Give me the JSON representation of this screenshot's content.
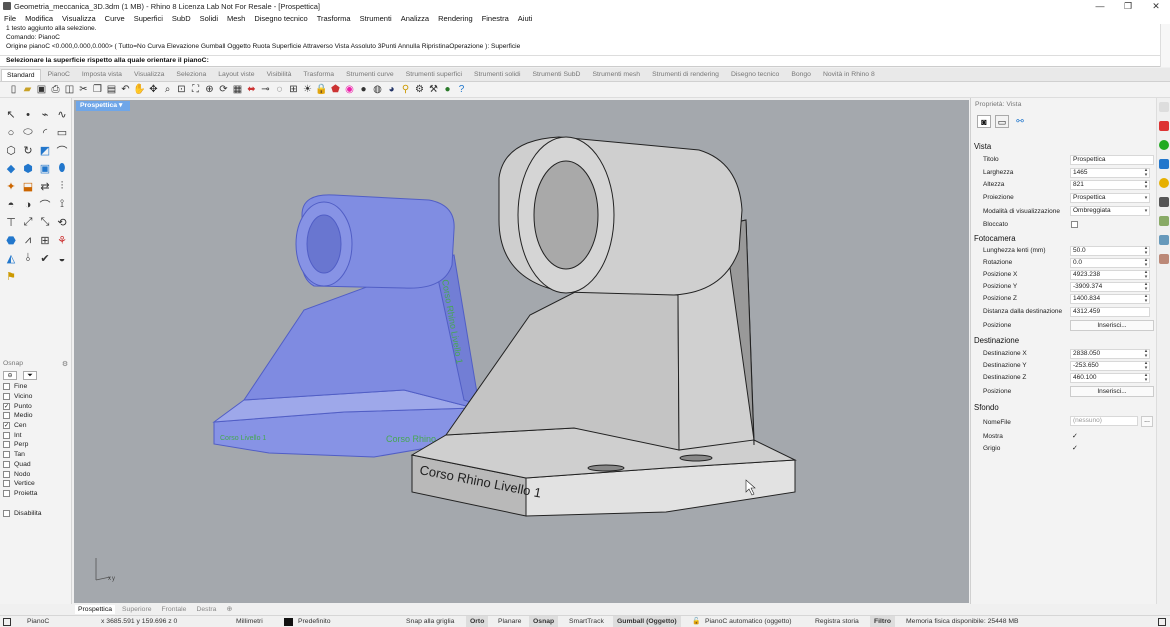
{
  "window": {
    "title": "Geometria_meccanica_3D.3dm (1 MB) - Rhino 8 Licenza Lab Not For Resale - [Prospettica]",
    "minimize": "—",
    "maximize": "❐",
    "close": "✕"
  },
  "menu": [
    "File",
    "Modifica",
    "Visualizza",
    "Curve",
    "Superfici",
    "SubD",
    "Solidi",
    "Mesh",
    "Disegno tecnico",
    "Trasforma",
    "Strumenti",
    "Analizza",
    "Rendering",
    "Finestra",
    "Aiuti"
  ],
  "command": {
    "history": [
      "1 testo aggiunto alla selezione.",
      "Comando: PianoC",
      "Origine pianoC <0.000,0.000,0.000> ( Tutto=No  Curva  Elevazione  Gumball  Oggetto  Ruota  Superficie  Attraverso  Vista  Assoluto  3Punti  Annulla  RipristinaOperazione ): Superficie"
    ],
    "prompt": "Selezionare la superficie rispetto alla quale orientare il pianoC:"
  },
  "toolbar_tabs": [
    "Standard",
    "PianoC",
    "Imposta vista",
    "Visualizza",
    "Seleziona",
    "Layout viste",
    "Visibilità",
    "Trasforma",
    "Strumenti curve",
    "Strumenti superfici",
    "Strumenti solidi",
    "Strumenti SubD",
    "Strumenti mesh",
    "Strumenti di rendering",
    "Disegno tecnico",
    "Bongo",
    "Novità in Rhino 8"
  ],
  "toolbar_tabs_active": 0,
  "viewport": {
    "name": "Prospettica",
    "dropdown": "▾",
    "ghost_text_1": "Corso Rhino Livello 1",
    "ghost_text_2": "Corso Livello 1",
    "ghost_text_3": "Corso Rhino",
    "solid_text": "Corso Rhino Livello 1",
    "axis_x": "x",
    "axis_y": "y"
  },
  "viewport_tabs": [
    "Prospettica",
    "Superiore",
    "Frontale",
    "Destra"
  ],
  "viewport_tabs_add": "⊕",
  "osnap": {
    "title": "Osnap",
    "items": [
      {
        "label": "Fine",
        "checked": false
      },
      {
        "label": "Vicino",
        "checked": false
      },
      {
        "label": "Punto",
        "checked": true
      },
      {
        "label": "Medio",
        "checked": false
      },
      {
        "label": "Cen",
        "checked": true
      },
      {
        "label": "Int",
        "checked": false
      },
      {
        "label": "Perp",
        "checked": false
      },
      {
        "label": "Tan",
        "checked": false
      },
      {
        "label": "Quad",
        "checked": false
      },
      {
        "label": "Nodo",
        "checked": false
      },
      {
        "label": "Vertice",
        "checked": false
      },
      {
        "label": "Proietta",
        "checked": false
      }
    ],
    "disable": "Disabilita"
  },
  "properties": {
    "title": "Proprietà: Vista",
    "vista": {
      "section": "Vista",
      "titolo_label": "Titolo",
      "titolo": "Prospettica",
      "larghezza_label": "Larghezza",
      "larghezza": "1465",
      "altezza_label": "Altezza",
      "altezza": "821",
      "proiezione_label": "Proiezione",
      "proiezione": "Prospettica",
      "modalita_label": "Modalità di visualizzazione",
      "modalita": "Ombreggiata",
      "bloccato_label": "Bloccato"
    },
    "fotocamera": {
      "section": "Fotocamera",
      "lente_label": "Lunghezza lenti (mm)",
      "lente": "50.0",
      "rotazione_label": "Rotazione",
      "rotazione": "0.0",
      "posx_label": "Posizione X",
      "posx": "4923.238",
      "posy_label": "Posizione Y",
      "posy": "-3909.374",
      "posz_label": "Posizione Z",
      "posz": "1400.834",
      "dist_label": "Distanza dalla destinazione",
      "dist": "4312.459",
      "pos_label": "Posizione",
      "pos_btn": "Inserisci..."
    },
    "destinazione": {
      "section": "Destinazione",
      "dx_label": "Destinazione X",
      "dx": "2838.050",
      "dy_label": "Destinazione Y",
      "dy": "-253.650",
      "dz_label": "Destinazione Z",
      "dz": "460.100",
      "pos_label": "Posizione",
      "pos_btn": "Inserisci..."
    },
    "sfondo": {
      "section": "Sfondo",
      "nomefile_label": "NomeFile",
      "nomefile": "(nessuno)",
      "browse": "...",
      "mostra_label": "Mostra",
      "mostra": "✓",
      "grigio_label": "Grigio",
      "grigio": "✓"
    }
  },
  "status": {
    "cplane": "PianoC",
    "coords": "x 3685.591  y 159.696  z 0",
    "units": "Millimetri",
    "layer": "Predefinito",
    "snap": "Snap alla griglia",
    "orto": "Orto",
    "planare": "Planare",
    "osnap": "Osnap",
    "smarttrack": "SmartTrack",
    "gumball": "Gumball (Oggetto)",
    "lock": "🔓",
    "autocplane": "PianoC automatico (oggetto)",
    "storia": "Registra storia",
    "filtro": "Filtro",
    "memoria": "Memoria fisica disponibile: 25448 MB"
  },
  "colors": {
    "viewport_bg": "#a4a8ad",
    "selection": "#7a89e8",
    "active_tab": "#6fa6e8",
    "solid_light": "#dedede",
    "label_green": "#3fa84a"
  }
}
